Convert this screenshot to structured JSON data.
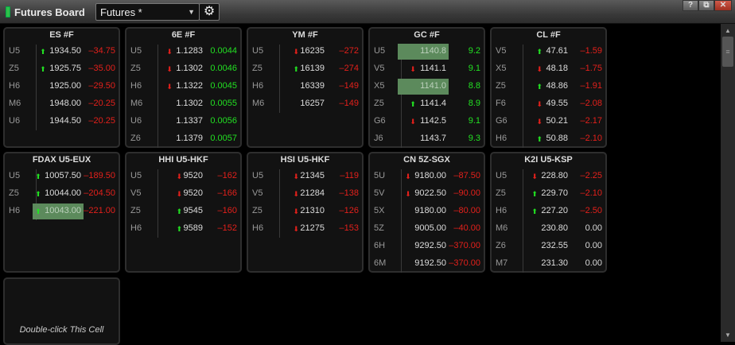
{
  "window": {
    "title": "Futures Board",
    "board_select": "Futures *",
    "help": "?",
    "restore": "⧉",
    "close": "✕"
  },
  "colors": {
    "up": "#22e022",
    "down": "#e3201b",
    "neutral": "#d8d8d8"
  },
  "hint_card": {
    "text": "Double-click This Cell"
  },
  "cards": [
    {
      "title": "ES #F",
      "rows": [
        {
          "month": "U5",
          "price": "1934.50",
          "change": "–34.75",
          "dir": "up",
          "tone": "down"
        },
        {
          "month": "Z5",
          "price": "1925.75",
          "change": "–35.00",
          "dir": "up",
          "tone": "down"
        },
        {
          "month": "H6",
          "price": "1925.00",
          "change": "–29.50",
          "dir": "",
          "tone": "down"
        },
        {
          "month": "M6",
          "price": "1948.00",
          "change": "–20.25",
          "dir": "",
          "tone": "down"
        },
        {
          "month": "U6",
          "price": "1944.50",
          "change": "–20.25",
          "dir": "",
          "tone": "down"
        }
      ]
    },
    {
      "title": "6E #F",
      "rows": [
        {
          "month": "U5",
          "price": "1.1283",
          "change": "0.0044",
          "dir": "down",
          "tone": "up"
        },
        {
          "month": "Z5",
          "price": "1.1302",
          "change": "0.0046",
          "dir": "down",
          "tone": "up"
        },
        {
          "month": "H6",
          "price": "1.1322",
          "change": "0.0045",
          "dir": "down",
          "tone": "up"
        },
        {
          "month": "M6",
          "price": "1.1302",
          "change": "0.0055",
          "dir": "",
          "tone": "up"
        },
        {
          "month": "U6",
          "price": "1.1337",
          "change": "0.0056",
          "dir": "",
          "tone": "up"
        },
        {
          "month": "Z6",
          "price": "1.1379",
          "change": "0.0057",
          "dir": "",
          "tone": "up"
        }
      ]
    },
    {
      "title": "YM #F",
      "rows": [
        {
          "month": "U5",
          "price": "16235",
          "change": "–272",
          "dir": "down",
          "tone": "down"
        },
        {
          "month": "Z5",
          "price": "16139",
          "change": "–274",
          "dir": "up",
          "tone": "down"
        },
        {
          "month": "H6",
          "price": "16339",
          "change": "–149",
          "dir": "",
          "tone": "down"
        },
        {
          "month": "M6",
          "price": "16257",
          "change": "–149",
          "dir": "",
          "tone": "down"
        }
      ]
    },
    {
      "title": "GC #F",
      "rows": [
        {
          "month": "U5",
          "price": "1140.8",
          "change": "9.2",
          "dir": "",
          "tone": "up",
          "highlight": true
        },
        {
          "month": "V5",
          "price": "1141.1",
          "change": "9.1",
          "dir": "down",
          "tone": "up"
        },
        {
          "month": "X5",
          "price": "1141.0",
          "change": "8.8",
          "dir": "",
          "tone": "up",
          "highlight": true
        },
        {
          "month": "Z5",
          "price": "1141.4",
          "change": "8.9",
          "dir": "up",
          "tone": "up"
        },
        {
          "month": "G6",
          "price": "1142.5",
          "change": "9.1",
          "dir": "down",
          "tone": "up"
        },
        {
          "month": "J6",
          "price": "1143.7",
          "change": "9.3",
          "dir": "",
          "tone": "up"
        }
      ]
    },
    {
      "title": "CL #F",
      "rows": [
        {
          "month": "V5",
          "price": "47.61",
          "change": "–1.59",
          "dir": "up",
          "tone": "down"
        },
        {
          "month": "X5",
          "price": "48.18",
          "change": "–1.75",
          "dir": "down",
          "tone": "down"
        },
        {
          "month": "Z5",
          "price": "48.86",
          "change": "–1.91",
          "dir": "up",
          "tone": "down"
        },
        {
          "month": "F6",
          "price": "49.55",
          "change": "–2.08",
          "dir": "down",
          "tone": "down"
        },
        {
          "month": "G6",
          "price": "50.21",
          "change": "–2.17",
          "dir": "down",
          "tone": "down"
        },
        {
          "month": "H6",
          "price": "50.88",
          "change": "–2.10",
          "dir": "up",
          "tone": "down"
        }
      ]
    },
    {
      "title": "FDAX U5-EUX",
      "rows": [
        {
          "month": "U5",
          "price": "10057.50",
          "change": "–189.50",
          "dir": "up",
          "tone": "down"
        },
        {
          "month": "Z5",
          "price": "10044.00",
          "change": "–204.50",
          "dir": "up",
          "tone": "down"
        },
        {
          "month": "H6",
          "price": "10043.00",
          "change": "–221.00",
          "dir": "up",
          "tone": "down",
          "highlight": true
        }
      ]
    },
    {
      "title": "HHI U5-HKF",
      "rows": [
        {
          "month": "U5",
          "price": "9520",
          "change": "–162",
          "dir": "down",
          "tone": "down"
        },
        {
          "month": "V5",
          "price": "9520",
          "change": "–166",
          "dir": "down",
          "tone": "down"
        },
        {
          "month": "Z5",
          "price": "9545",
          "change": "–160",
          "dir": "up",
          "tone": "down"
        },
        {
          "month": "H6",
          "price": "9589",
          "change": "–152",
          "dir": "up",
          "tone": "down"
        }
      ]
    },
    {
      "title": "HSI U5-HKF",
      "rows": [
        {
          "month": "U5",
          "price": "21345",
          "change": "–119",
          "dir": "down",
          "tone": "down"
        },
        {
          "month": "V5",
          "price": "21284",
          "change": "–138",
          "dir": "down",
          "tone": "down"
        },
        {
          "month": "Z5",
          "price": "21310",
          "change": "–126",
          "dir": "down",
          "tone": "down"
        },
        {
          "month": "H6",
          "price": "21275",
          "change": "–153",
          "dir": "down",
          "tone": "down"
        }
      ]
    },
    {
      "title": "CN 5Z-SGX",
      "rows": [
        {
          "month": "5U",
          "price": "9180.00",
          "change": "–87.50",
          "dir": "down",
          "tone": "down"
        },
        {
          "month": "5V",
          "price": "9022.50",
          "change": "–90.00",
          "dir": "down",
          "tone": "down"
        },
        {
          "month": "5X",
          "price": "9180.00",
          "change": "–80.00",
          "dir": "",
          "tone": "down"
        },
        {
          "month": "5Z",
          "price": "9005.00",
          "change": "–40.00",
          "dir": "",
          "tone": "down"
        },
        {
          "month": "6H",
          "price": "9292.50",
          "change": "–370.00",
          "dir": "",
          "tone": "down"
        },
        {
          "month": "6M",
          "price": "9192.50",
          "change": "–370.00",
          "dir": "",
          "tone": "down"
        }
      ]
    },
    {
      "title": "K2I U5-KSP",
      "rows": [
        {
          "month": "U5",
          "price": "228.80",
          "change": "–2.25",
          "dir": "down",
          "tone": "down"
        },
        {
          "month": "Z5",
          "price": "229.70",
          "change": "–2.10",
          "dir": "up",
          "tone": "down"
        },
        {
          "month": "H6",
          "price": "227.20",
          "change": "–2.50",
          "dir": "up",
          "tone": "down"
        },
        {
          "month": "M6",
          "price": "230.80",
          "change": "0.00",
          "dir": "",
          "tone": "neutral"
        },
        {
          "month": "Z6",
          "price": "232.55",
          "change": "0.00",
          "dir": "",
          "tone": "neutral"
        },
        {
          "month": "M7",
          "price": "231.30",
          "change": "0.00",
          "dir": "",
          "tone": "neutral"
        }
      ]
    }
  ]
}
